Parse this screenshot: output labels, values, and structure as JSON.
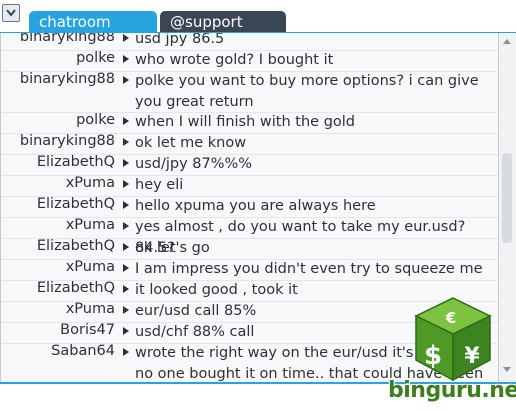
{
  "tabs": [
    {
      "label": "chatroom",
      "active": true
    },
    {
      "label": "@support",
      "active": false
    }
  ],
  "colors": {
    "accent": "#27a3e0",
    "tab_inactive": "#3b4654",
    "logo_green": "#3d7f1f"
  },
  "messages": [
    {
      "user": "binaryking88",
      "text": "usd jpy 86.5"
    },
    {
      "user": "polke",
      "text": "who wrote gold? I bought it"
    },
    {
      "user": "binaryking88",
      "text": "polke you want to buy more options? i can give you great return"
    },
    {
      "user": "polke",
      "text": "when I will finish with the gold"
    },
    {
      "user": "binaryking88",
      "text": "ok let me know"
    },
    {
      "user": "ElizabethQ",
      "text": "usd/jpy 87%%%"
    },
    {
      "user": "xPuma",
      "text": "hey eli"
    },
    {
      "user": "ElizabethQ",
      "text": "hello xpuma you are always here"
    },
    {
      "user": "xPuma",
      "text": "yes almost , do you want to take my eur.usd? 84.5?"
    },
    {
      "user": "ElizabethQ",
      "text": "ok let's go"
    },
    {
      "user": "xPuma",
      "text": "I am impress you didn't even try to squeeze me"
    },
    {
      "user": "ElizabethQ",
      "text": "it looked good , took it"
    },
    {
      "user": "xPuma",
      "text": "eur/usd call 85%"
    },
    {
      "user": "Boris47",
      "text": "usd/chf 88% call"
    },
    {
      "user": "Saban64",
      "text": "wrote the right way on the eur/usd it's a shame no one bought it on time.. that could have been sweet"
    }
  ],
  "watermark": {
    "text": "binguru.net",
    "icon": "currency-cube-icon"
  }
}
